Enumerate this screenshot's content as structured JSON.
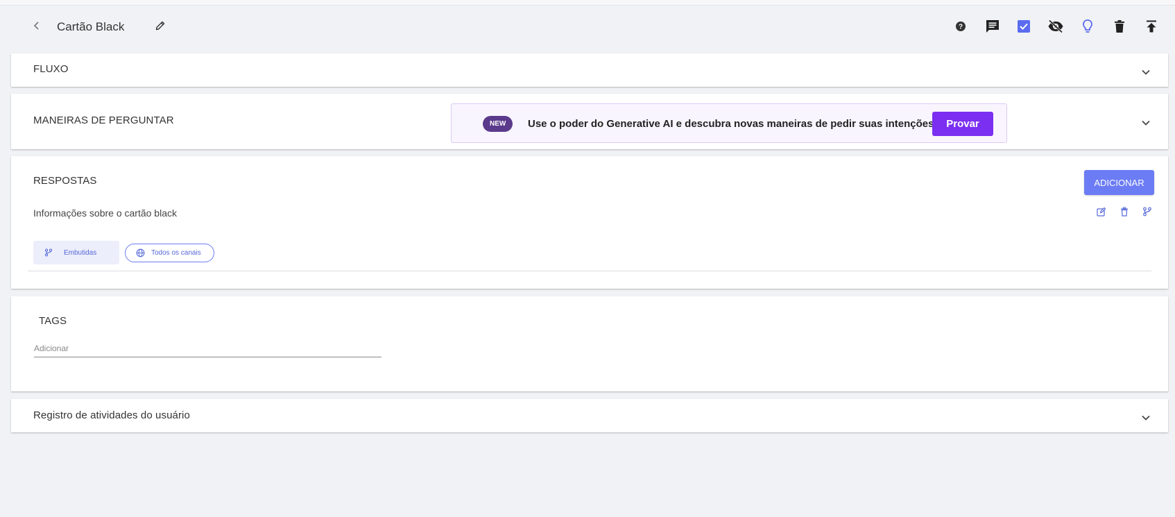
{
  "header": {
    "title": "Cartão Black",
    "toolbar": [
      {
        "name": "help-icon"
      },
      {
        "name": "comment-icon"
      },
      {
        "name": "checkbox-checked-icon"
      },
      {
        "name": "eye-off-icon"
      },
      {
        "name": "lightbulb-icon"
      },
      {
        "name": "trash-icon"
      },
      {
        "name": "publish-icon"
      }
    ]
  },
  "sections": {
    "flow": {
      "title": "FLUXO"
    },
    "ways_to_ask": {
      "title": "MANEIRAS DE PERGUNTAR"
    },
    "responses": {
      "title": "RESPOSTAS",
      "add_label": "ADICIONAR"
    },
    "tags": {
      "title": "TAGS",
      "placeholder": "Adicionar"
    },
    "activity_log": {
      "title": "Registro de atividades do usuário"
    }
  },
  "promo": {
    "badge": "NEW",
    "text": "Use o poder do Generative AI e descubra novas maneiras de pedir suas intenções.",
    "button": "Provar"
  },
  "response": {
    "text": "Informações sobre o cartão black",
    "chips": {
      "embedded": "Embutidas",
      "channels": "Todos os canais"
    }
  },
  "colors": {
    "accent": "#6b7cf4",
    "promo_button": "#7b2ff0",
    "badge": "#5b3a8c",
    "background": "#f1f2f5"
  }
}
